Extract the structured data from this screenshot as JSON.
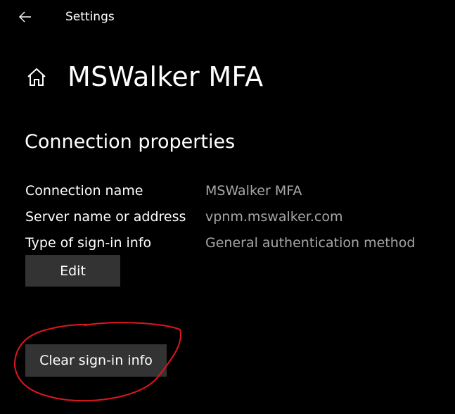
{
  "window": {
    "app_title": "Settings",
    "back_icon": "back-arrow-icon"
  },
  "header": {
    "home_icon": "home-icon",
    "title": "MSWalker MFA"
  },
  "section": {
    "title": "Connection properties"
  },
  "properties": [
    {
      "label": "Connection name",
      "value": "MSWalker MFA"
    },
    {
      "label": "Server name or address",
      "value": "vpnm.mswalker.com"
    },
    {
      "label": "Type of sign-in info",
      "value": "General authentication method"
    }
  ],
  "buttons": {
    "edit_label": "Edit",
    "clear_label": "Clear sign-in info"
  },
  "colors": {
    "background": "#000000",
    "text": "#ffffff",
    "value_text": "#a6a6a6",
    "button_bg": "#333333",
    "annotation": "#e0161d"
  }
}
